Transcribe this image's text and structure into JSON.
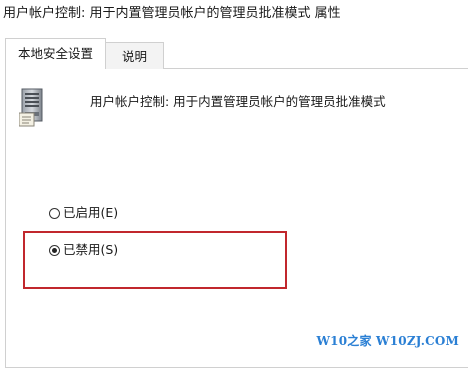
{
  "window": {
    "title": "用户帐户控制: 用于内置管理员帐户的管理员批准模式 属性"
  },
  "tabs": [
    {
      "label": "本地安全设置",
      "active": true
    },
    {
      "label": "说明",
      "active": false
    }
  ],
  "policy": {
    "icon": "server-policy-icon",
    "name": "用户帐户控制: 用于内置管理员帐户的管理员批准模式"
  },
  "options": {
    "enabled": {
      "label": "已启用(E)",
      "checked": false
    },
    "disabled": {
      "label": "已禁用(S)",
      "checked": true
    }
  },
  "annotation": {
    "highlight_color": "#c1272d"
  },
  "watermark": {
    "text": "W10之家 W10ZJ.COM",
    "color": "#2a7fd4"
  }
}
